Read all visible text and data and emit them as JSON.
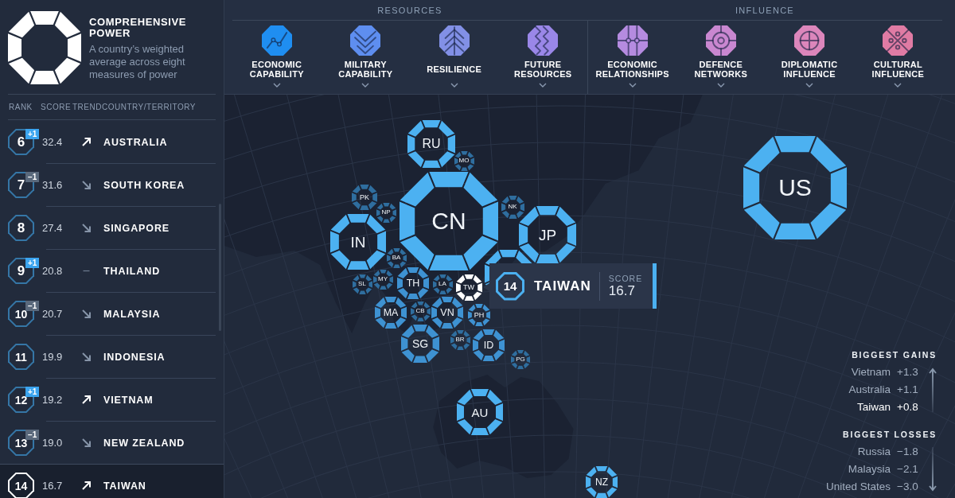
{
  "sidebar": {
    "title": "COMPREHENSIVE POWER",
    "description": "A country’s weighted average across eight measures of power",
    "columns": [
      "RANK",
      "SCORE",
      "TREND",
      "COUNTRY/TERRITORY"
    ],
    "rows": [
      {
        "rank": "6",
        "rank_change": {
          "text": "+1",
          "color": "#3ba4ef"
        },
        "score": "32.4",
        "trend": {
          "kind": "up"
        },
        "name": "AUSTRALIA",
        "selected": false
      },
      {
        "rank": "7",
        "rank_change": {
          "text": "−1",
          "color": "#5a697c"
        },
        "score": "31.6",
        "trend": {
          "kind": "down"
        },
        "name": "SOUTH KOREA",
        "selected": false
      },
      {
        "rank": "8",
        "score": "27.4",
        "trend": {
          "kind": "down"
        },
        "name": "SINGAPORE",
        "selected": false
      },
      {
        "rank": "9",
        "rank_change": {
          "text": "+1",
          "color": "#3ba4ef"
        },
        "score": "20.8",
        "trend": {
          "kind": "flat"
        },
        "name": "THAILAND",
        "selected": false
      },
      {
        "rank": "10",
        "rank_change": {
          "text": "−1",
          "color": "#5a697c"
        },
        "score": "20.7",
        "trend": {
          "kind": "down"
        },
        "name": "MALAYSIA",
        "selected": false
      },
      {
        "rank": "11",
        "score": "19.9",
        "trend": {
          "kind": "down"
        },
        "name": "INDONESIA",
        "selected": false
      },
      {
        "rank": "12",
        "rank_change": {
          "text": "+1",
          "color": "#3ba4ef"
        },
        "score": "19.2",
        "trend": {
          "kind": "up"
        },
        "name": "VIETNAM",
        "selected": false
      },
      {
        "rank": "13",
        "rank_change": {
          "text": "−1",
          "color": "#5a697c"
        },
        "score": "19.0",
        "trend": {
          "kind": "down"
        },
        "name": "NEW ZEALAND",
        "selected": false
      },
      {
        "rank": "14",
        "score": "16.7",
        "trend": {
          "kind": "up"
        },
        "name": "TAIWAN",
        "selected": true
      }
    ]
  },
  "categories": {
    "groups": [
      {
        "label": "RESOURCES",
        "items": [
          {
            "label": "ECONOMIC CAPABILITY",
            "color": "#1f8ef1"
          },
          {
            "label": "MILITARY CAPABILITY",
            "color": "#5e8ef0"
          },
          {
            "label": "RESILIENCE",
            "color": "#8290e6"
          },
          {
            "label": "FUTURE RESOURCES",
            "color": "#9a87e8"
          }
        ]
      },
      {
        "label": "INFLUENCE",
        "items": [
          {
            "label": "ECONOMIC RELATIONSHIPS",
            "color": "#b58be0"
          },
          {
            "label": "DEFENCE NETWORKS",
            "color": "#c987d0"
          },
          {
            "label": "DIPLOMATIC INFLUENCE",
            "color": "#dc86bb"
          },
          {
            "label": "CULTURAL INFLUENCE",
            "color": "#e07ba4"
          }
        ]
      }
    ]
  },
  "map": {
    "nodes": [
      {
        "code": "RU",
        "kind": "major",
        "selected": false
      },
      {
        "code": "MO",
        "kind": "minor",
        "selected": false
      },
      {
        "code": "US",
        "kind": "major",
        "selected": false
      },
      {
        "code": "PK",
        "kind": "minor",
        "selected": false
      },
      {
        "code": "NP",
        "kind": "minor",
        "selected": false
      },
      {
        "code": "NK",
        "kind": "minor",
        "selected": false
      },
      {
        "code": "IN",
        "kind": "major",
        "selected": false
      },
      {
        "code": "CN",
        "kind": "major",
        "selected": false
      },
      {
        "code": "JP",
        "kind": "major",
        "selected": false
      },
      {
        "code": "BA",
        "kind": "minor",
        "selected": false
      },
      {
        "code": "SL",
        "kind": "minor",
        "selected": false
      },
      {
        "code": "MY",
        "kind": "minor",
        "selected": false
      },
      {
        "code": "TH",
        "kind": "middle",
        "selected": false
      },
      {
        "code": "LA",
        "kind": "minor",
        "selected": false
      },
      {
        "code": "TW",
        "kind": "middle",
        "selected": true
      },
      {
        "kind": "major",
        "selected": false
      },
      {
        "code": "MA",
        "kind": "middle",
        "selected": false
      },
      {
        "code": "CB",
        "kind": "minor",
        "selected": false
      },
      {
        "code": "VN",
        "kind": "middle",
        "selected": false
      },
      {
        "code": "PH",
        "kind": "middle",
        "selected": false
      },
      {
        "code": "SG",
        "kind": "middle",
        "selected": false
      },
      {
        "code": "BR",
        "kind": "minor",
        "selected": false
      },
      {
        "code": "ID",
        "kind": "middle",
        "selected": false
      },
      {
        "code": "PG",
        "kind": "minor",
        "selected": false
      },
      {
        "code": "AU",
        "kind": "major",
        "selected": false
      },
      {
        "code": "NZ",
        "kind": "major",
        "selected": false
      }
    ],
    "tooltip": {
      "rank": "14",
      "name": "TAIWAN",
      "score_label": "SCORE",
      "score": "16.7"
    },
    "legend": {
      "sections": [
        {
          "kind": "gains",
          "title": "BIGGEST GAINS",
          "entries": [
            {
              "name": "Vietnam",
              "value": "+1.3",
              "highlighted": false
            },
            {
              "name": "Australia",
              "value": "+1.1",
              "highlighted": false
            },
            {
              "name": "Taiwan",
              "value": "+0.8",
              "highlighted": true
            }
          ]
        },
        {
          "kind": "losses",
          "title": "BIGGEST LOSSES",
          "entries": [
            {
              "name": "Russia",
              "value": "−1.8",
              "highlighted": false
            },
            {
              "name": "Malaysia",
              "value": "−2.1",
              "highlighted": false
            },
            {
              "name": "United States",
              "value": "−3.0",
              "highlighted": false
            }
          ]
        }
      ]
    }
  }
}
